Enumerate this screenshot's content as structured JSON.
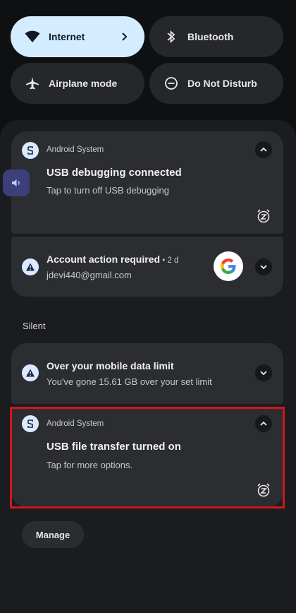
{
  "quick_settings": {
    "internet": "Internet",
    "bluetooth": "Bluetooth",
    "airplane": "Airplane mode",
    "dnd": "Do Not Disturb"
  },
  "notifications": {
    "usb_debugging": {
      "app": "Android System",
      "title": "USB debugging connected",
      "text": "Tap to turn off USB debugging"
    },
    "account": {
      "title": "Account action required",
      "time": " • 2 d",
      "text": "jdevi440@gmail.com"
    },
    "section_silent": "Silent",
    "data_limit": {
      "title": "Over your mobile data limit",
      "text": "You've gone 15.61 GB over your set limit"
    },
    "usb_transfer": {
      "app": "Android System",
      "title": "USB file transfer turned on",
      "text": "Tap for more options."
    }
  },
  "manage_label": "Manage",
  "colors": {
    "accent_tile": "#d4ecff",
    "highlight": "#d2151c",
    "card": "#2b2d31"
  }
}
